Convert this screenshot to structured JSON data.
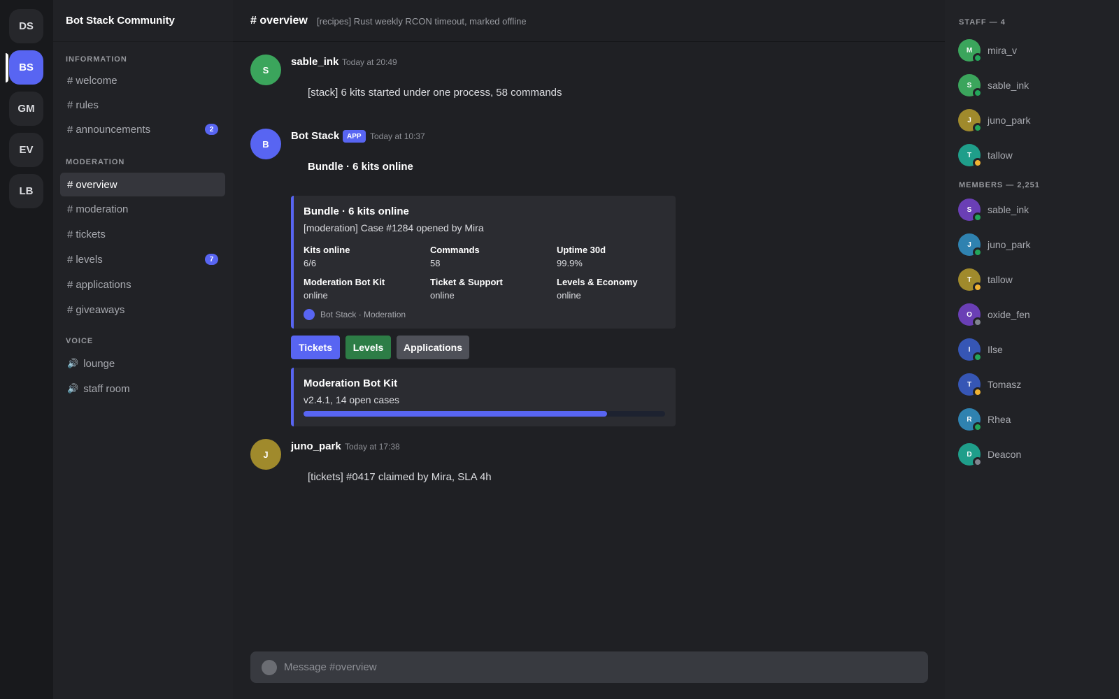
{
  "servers": [
    {
      "label": "DS",
      "active": false
    },
    {
      "label": "BS",
      "active": true
    },
    {
      "label": "GM",
      "active": false
    },
    {
      "label": "EV",
      "active": false
    },
    {
      "label": "LB",
      "active": false
    }
  ],
  "guild": {
    "name": "Bot Stack Community"
  },
  "categories": {
    "information": "INFORMATION",
    "moderation": "MODERATION",
    "voice": "VOICE"
  },
  "channels": {
    "information": [
      {
        "name": "welcome",
        "badge": ""
      },
      {
        "name": "rules",
        "badge": ""
      },
      {
        "name": "announcements",
        "badge": "2"
      }
    ],
    "moderation": [
      {
        "name": "overview",
        "badge": "",
        "active": true
      },
      {
        "name": "moderation",
        "badge": ""
      },
      {
        "name": "tickets",
        "badge": ""
      },
      {
        "name": "levels",
        "badge": "7"
      },
      {
        "name": "applications",
        "badge": ""
      },
      {
        "name": "giveaways",
        "badge": ""
      }
    ],
    "voice": [
      {
        "name": "lounge"
      },
      {
        "name": "staff room"
      }
    ]
  },
  "header": {
    "channel": "# overview",
    "topic": "[recipes] Rust weekly RCON timeout, marked offline"
  },
  "messages": [
    {
      "author": "sable_ink",
      "initial": "S",
      "time": "Today at 20:49",
      "text": "[stack] 6 kits started under one process, 58 commands",
      "avatar_color": "#3ba55c"
    },
    {
      "author": "Bot Stack",
      "initial": "B",
      "tag": "APP",
      "time": "Today at 10:37",
      "text": "Bundle · 6 kits online",
      "avatar_color": "#5865f2"
    },
    {
      "author": "juno_park",
      "initial": "J",
      "time": "Today at 17:38",
      "text": "[tickets] #0417 claimed by Mira, SLA 4h",
      "avatar_color": "#a08a2c"
    }
  ],
  "embed": {
    "title": "Bundle · 6 kits online",
    "description": "[moderation] Case #1284 opened by Mira",
    "fields": [
      {
        "name": "Kits online",
        "value": "6/6"
      },
      {
        "name": "Commands",
        "value": "58"
      },
      {
        "name": "Uptime 30d",
        "value": "99.9%"
      },
      {
        "name": "Moderation Bot Kit",
        "value": "online"
      },
      {
        "name": "Ticket & Support",
        "value": "online"
      },
      {
        "name": "Levels & Economy",
        "value": "online"
      }
    ],
    "footer": "Bot Stack · Moderation"
  },
  "buttons": [
    {
      "label": "Tickets",
      "color": "#5865f2"
    },
    {
      "label": "Levels",
      "color": "#2d7d46"
    },
    {
      "label": "Applications",
      "color": "#4e5058"
    }
  ],
  "kit_embed": {
    "title": "Moderation Bot Kit",
    "description": "v2.4.1, 14 open cases",
    "progress": 0.84
  },
  "composer": {
    "placeholder": "Message #overview"
  },
  "member_groups": {
    "staff": "STAFF — 4",
    "members": "MEMBERS — 2,251"
  },
  "staff": [
    {
      "name": "mira_v",
      "initial": "M",
      "color": "#3ba55c",
      "status": "online"
    },
    {
      "name": "sable_ink",
      "initial": "S",
      "color": "#3ba55c",
      "status": "online"
    },
    {
      "name": "juno_park",
      "initial": "J",
      "color": "#a08a2c",
      "status": "online"
    },
    {
      "name": "tallow",
      "initial": "T",
      "color": "#1f9e8a",
      "status": "idle"
    }
  ],
  "members": [
    {
      "name": "sable_ink",
      "initial": "S",
      "color": "#6a3fb5",
      "status": "online"
    },
    {
      "name": "juno_park",
      "initial": "J",
      "color": "#2f82b0",
      "status": "online"
    },
    {
      "name": "tallow",
      "initial": "T",
      "color": "#a08a2c",
      "status": "idle"
    },
    {
      "name": "oxide_fen",
      "initial": "O",
      "color": "#6a3fb5",
      "status": "offline"
    },
    {
      "name": "Ilse",
      "initial": "I",
      "color": "#3656b5",
      "status": "online"
    },
    {
      "name": "Tomasz",
      "initial": "T",
      "color": "#3656b5",
      "status": "idle"
    },
    {
      "name": "Rhea",
      "initial": "R",
      "color": "#2f82b0",
      "status": "online"
    },
    {
      "name": "Deacon",
      "initial": "D",
      "color": "#1f9e8a",
      "status": "offline"
    }
  ],
  "status_colors": {
    "online": "#23a55a",
    "idle": "#f0b232",
    "offline": "#80848e"
  }
}
